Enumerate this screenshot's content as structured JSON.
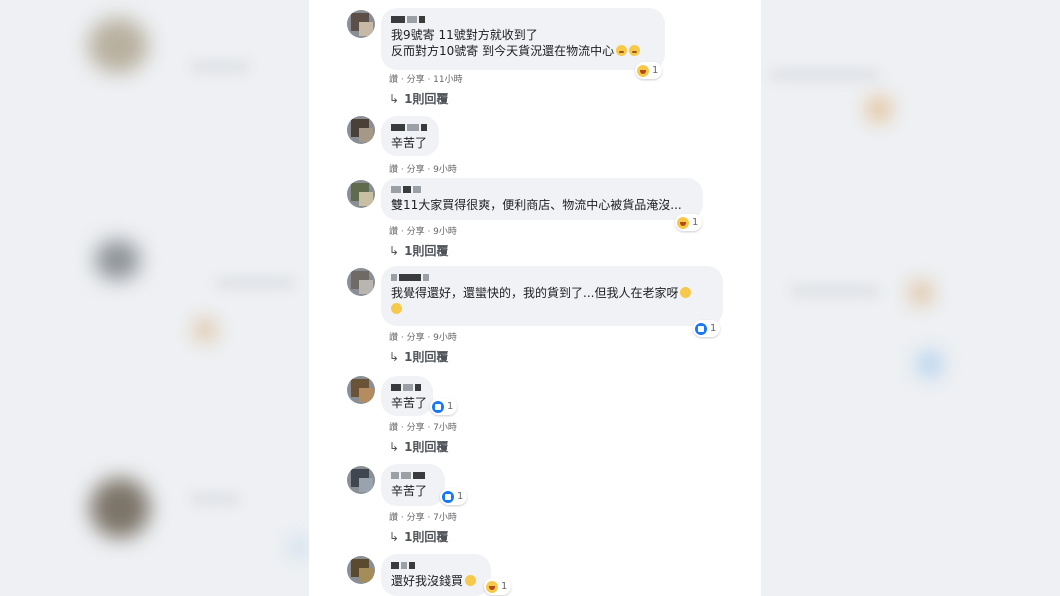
{
  "comments": [
    {
      "lines": [
        "我9號寄 11號對方就收到了",
        "反而對方10號寄 到今天貨況還在物流中心"
      ],
      "reaction": {
        "type": "haha",
        "count": "1"
      },
      "actions": "讚 · 分享 · 11小時",
      "reply": "1則回覆"
    },
    {
      "lines": [
        "辛苦了"
      ],
      "actions": "讚 · 分享 · 9小時"
    },
    {
      "lines": [
        "雙11大家買得很爽，便利商店、物流中心被貨品淹沒..."
      ],
      "reaction": {
        "type": "haha",
        "count": "1"
      },
      "actions": "讚 · 分享 · 9小時",
      "reply": "1則回覆"
    },
    {
      "lines": [
        "我覺得還好，還蠻快的，我的貨到了...但我人在老家呀"
      ],
      "reaction": {
        "type": "like",
        "count": "1"
      },
      "actions": "讚 · 分享 · 9小時",
      "reply": "1則回覆"
    },
    {
      "lines": [
        "辛苦了"
      ],
      "reaction": {
        "type": "like",
        "count": "1"
      },
      "actions": "讚 · 分享 · 7小時",
      "reply": "1則回覆"
    },
    {
      "lines": [
        "辛苦了"
      ],
      "reaction": {
        "type": "like",
        "count": "1"
      },
      "actions": "讚 · 分享 · 7小時",
      "reply": "1則回覆"
    },
    {
      "lines": [
        "還好我沒錢買"
      ],
      "reaction": {
        "type": "haha",
        "count": "1"
      }
    }
  ],
  "reply_arrow_icon": "reply-arrow-icon",
  "colors": {
    "bubble": "#f0f2f5",
    "like": "#1877f2",
    "haha": "#f7c94a",
    "text": "#1c1e21",
    "meta": "#65676b"
  }
}
